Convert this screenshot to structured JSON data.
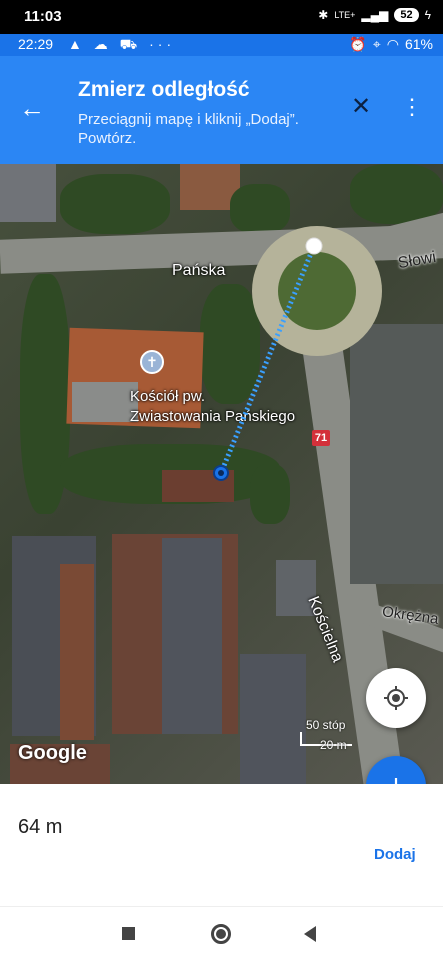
{
  "phone_status": {
    "time": "11:03",
    "network": "LTE+",
    "battery": "52"
  },
  "app_status": {
    "time": "22:29",
    "battery_percent": "61%"
  },
  "toolbar": {
    "title": "Zmierz odległość",
    "subtitle": "Przeciągnij mapę i kliknij „Dodaj”. Powtórz.",
    "back_icon": "arrow-back-icon",
    "close_icon": "close-icon",
    "menu_icon": "more-vert-icon"
  },
  "map": {
    "streets": [
      "Pańska",
      "Słowi",
      "Kościelna",
      "Okrężna"
    ],
    "poi_name_line1": "Kościół pw.",
    "poi_name_line2": "Zwiastowania Pańskiego",
    "route_badge": "71",
    "google_logo": "Google",
    "scale_feet": "50 stóp",
    "scale_meters": "20 m"
  },
  "panel": {
    "distance": "64 m",
    "add_label": "Dodaj"
  },
  "colors": {
    "toolbar": "#2b86f4",
    "accent": "#1a73e8",
    "measure_line": "#3aa0ff"
  }
}
